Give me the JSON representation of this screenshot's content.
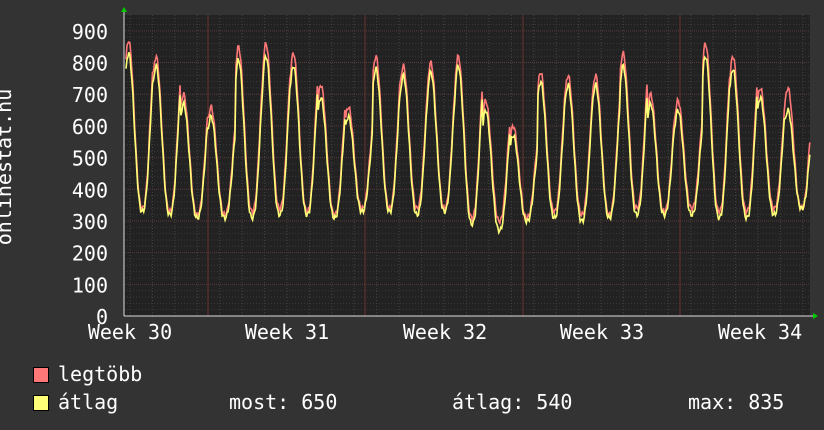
{
  "chart_data": {
    "type": "line",
    "ylabel": "onlinestat.hu",
    "ylim": [
      0,
      950
    ],
    "y_ticks": [
      0,
      100,
      200,
      300,
      400,
      500,
      600,
      700,
      800,
      900
    ],
    "x_ticks": [
      "Week 30",
      "Week 31",
      "Week 32",
      "Week 33",
      "Week 34"
    ],
    "grid": true,
    "legend_placement": "bottom-left",
    "series": [
      {
        "name": "legtöbb",
        "color": "#ff7777",
        "peaks": [
          870,
          820,
          700,
          660,
          850,
          860,
          830,
          730,
          660,
          820,
          790,
          800,
          820,
          680,
          600,
          770,
          760,
          760,
          830,
          700,
          680,
          860,
          820,
          720,
          720
        ],
        "troughs": [
          340,
          330,
          320,
          320,
          330,
          340,
          330,
          320,
          340,
          340,
          340,
          340,
          310,
          300,
          310,
          330,
          320,
          320,
          340,
          330,
          340,
          330,
          330,
          340,
          340
        ]
      },
      {
        "name": "átlag",
        "color": "#ffff77",
        "peaks": [
          830,
          790,
          670,
          630,
          810,
          820,
          790,
          690,
          630,
          780,
          760,
          770,
          790,
          650,
          570,
          740,
          730,
          730,
          790,
          670,
          650,
          820,
          780,
          690,
          650
        ],
        "troughs": [
          330,
          320,
          310,
          310,
          310,
          320,
          320,
          310,
          330,
          330,
          320,
          330,
          290,
          270,
          300,
          310,
          300,
          310,
          320,
          320,
          320,
          310,
          310,
          320,
          340
        ]
      }
    ]
  },
  "legend": {
    "items": [
      {
        "label": "legtöbb",
        "color": "#ff7777"
      },
      {
        "label": "átlag",
        "color": "#ffff77"
      }
    ],
    "stats": {
      "most": "most: 650",
      "atlag": "átlag: 540",
      "max": "max: 835"
    }
  }
}
